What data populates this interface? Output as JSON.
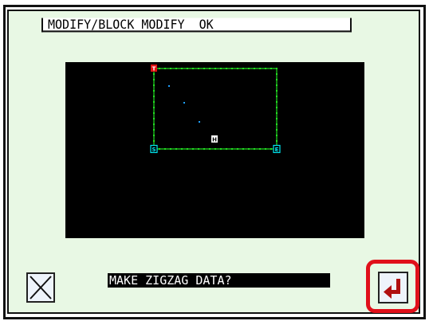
{
  "header": {
    "title": "MODIFY/BLOCK MODIFY  OK"
  },
  "canvas": {
    "markers": {
      "top": "T",
      "start": "S",
      "end": "E",
      "home": "H"
    },
    "colors": {
      "background": "#000000",
      "stitch_line": "#22dd22",
      "marker_top": "#e01010",
      "marker_start_end": "#00e5ee",
      "marker_home": "#ffffff",
      "points": "#1fa0ff"
    }
  },
  "message": {
    "text": "MAKE ZIGZAG DATA?"
  },
  "buttons": {
    "close_icon": "close-x-icon",
    "enter_icon": "enter-return-arrow-icon"
  },
  "colors": {
    "panel_background": "#e8f8e4",
    "highlight": "#e0101a",
    "enter_arrow": "#b01010"
  }
}
